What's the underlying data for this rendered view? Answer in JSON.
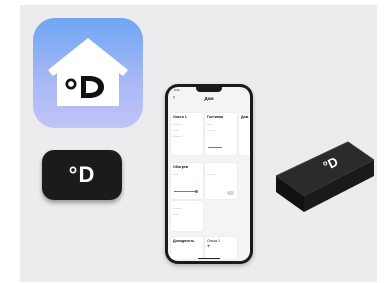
{
  "brand": {
    "logo_text": "°D",
    "colors": {
      "panel_bg": "#ecebed",
      "icon_gradient_top": "#6fa6f3",
      "icon_gradient_bottom": "#c3c3f6",
      "device_black": "#1b1b1d",
      "accent_blue": "#3b82f6"
    }
  },
  "phone": {
    "status_time": "9:41",
    "header_title": "Дом",
    "header_subtitle": "",
    "section_1": "",
    "card_1_title": "Ольга 1",
    "card_2_title": "Гостиная",
    "card_3_title": "Дом",
    "section_2": "",
    "card_4_title": "Обогрев",
    "card_5_title": "",
    "section_3": "",
    "card_6_title": "Доходность",
    "card_7_title": "Ольга 1"
  },
  "icons": [
    "house-logo-icon",
    "back-chevron-icon",
    "add-icon",
    "toggle-switch-icon"
  ]
}
